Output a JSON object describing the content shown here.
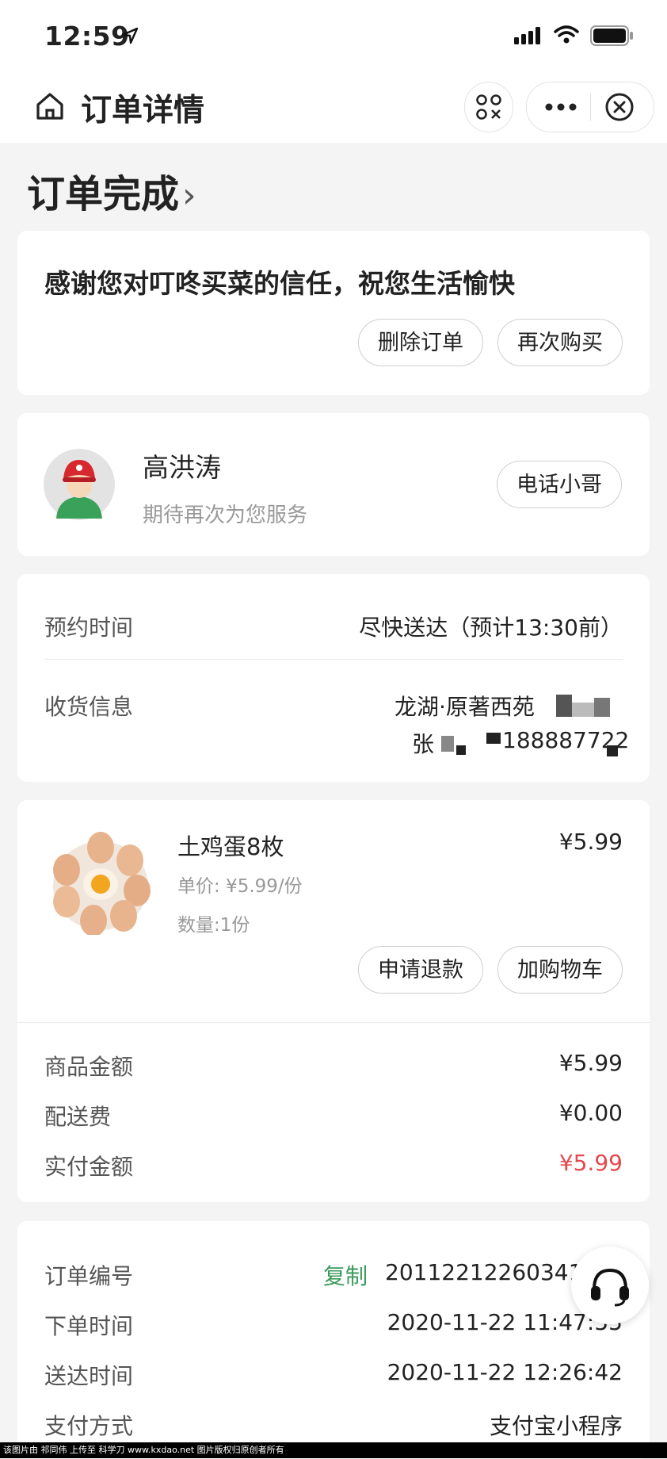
{
  "status_bar": {
    "time": "12:59"
  },
  "nav": {
    "title": "订单详情"
  },
  "order_status": {
    "title": "订单完成",
    "chevron": "›"
  },
  "thanks_card": {
    "message": "感谢您对叮咚买菜的信任，祝您生活愉快",
    "delete_label": "删除订单",
    "rebuy_label": "再次购买"
  },
  "courier": {
    "name": "高洪涛",
    "subtitle": "期待再次为您服务",
    "call_label": "电话小哥"
  },
  "delivery": {
    "time_label": "预约时间",
    "time_value": "尽快送达（预计13:30前）",
    "address_label": "收货信息",
    "address_line1": "龙湖·原著西苑",
    "address_line2_name": "张",
    "address_line2_phone": "188887722"
  },
  "product": {
    "name": "土鸡蛋8枚",
    "price": "¥5.99",
    "unit_price": "单价: ¥5.99/份",
    "quantity": "数量:1份",
    "refund_label": "申请退款",
    "add_cart_label": "加购物车"
  },
  "summary": {
    "goods_label": "商品金额",
    "goods_value": "¥5.99",
    "shipping_label": "配送费",
    "shipping_value": "¥0.00",
    "paid_label": "实付金额",
    "paid_value": "¥5.99",
    "paid_color": "#e5484d"
  },
  "order_info": {
    "number_label": "订单编号",
    "copy_label": "复制",
    "number_value": "201122122603414",
    "order_time_label": "下单时间",
    "order_time_value": "2020-11-22 11:47:55",
    "arrive_time_label": "送达时间",
    "arrive_time_value": "2020-11-22 12:26:42",
    "pay_method_label": "支付方式",
    "pay_method_value": "支付宝小程序"
  },
  "footer": {
    "watermark": "该图片由 祁同伟 上传至 科学刀 www.kxdao.net 图片版权归原创者所有"
  },
  "colors": {
    "accent_green": "#3a9a5b",
    "price_red": "#e5484d"
  },
  "icons": [
    "navigation-arrow-icon",
    "signal-icon",
    "wifi-icon",
    "battery-icon",
    "home-icon",
    "scan-icon",
    "more-icon",
    "close-icon",
    "headset-icon"
  ]
}
